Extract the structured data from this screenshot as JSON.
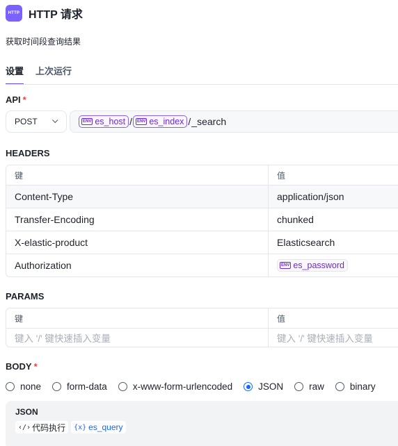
{
  "header": {
    "icon_text": "HTTP",
    "title": "HTTP 请求",
    "subtitle": "获取时间段查询结果"
  },
  "tabs": [
    {
      "label": "设置",
      "active": true
    },
    {
      "label": "上次运行",
      "active": false
    }
  ],
  "api": {
    "label": "API",
    "required_mark": "*",
    "method": "POST",
    "url": {
      "host_var": "es_host",
      "index_var": "es_index",
      "slash": "/",
      "path": "_search",
      "env_icon": "ENV"
    }
  },
  "headers": {
    "label": "HEADERS",
    "col_key": "键",
    "col_value": "值",
    "rows": [
      {
        "key": "Content-Type",
        "value": "application/json"
      },
      {
        "key": "Transfer-Encoding",
        "value": "chunked"
      },
      {
        "key": "X-elastic-product",
        "value": "Elasticsearch"
      },
      {
        "key": "Authorization",
        "value_var": "es_password"
      }
    ]
  },
  "params": {
    "label": "PARAMS",
    "col_key": "键",
    "col_value": "值",
    "key_placeholder": "键入 '/' 键快速插入变量",
    "value_placeholder": "键入 '/' 键快速插入变量"
  },
  "body": {
    "label": "BODY",
    "required_mark": "*",
    "options": [
      {
        "label": "none",
        "checked": false
      },
      {
        "label": "form-data",
        "checked": false
      },
      {
        "label": "x-www-form-urlencoded",
        "checked": false
      },
      {
        "label": "JSON",
        "checked": true
      },
      {
        "label": "raw",
        "checked": false
      },
      {
        "label": "binary",
        "checked": false
      }
    ],
    "json_title": "JSON",
    "code_tag": "代码执行",
    "code_icon": "‹/›",
    "var_icon": "{x}",
    "var_tag": "es_query"
  },
  "colors": {
    "accent": "#6b4eff",
    "env_tag": "#8b5cf6",
    "required": "#f53f3f",
    "radio_checked": "#1664ff"
  }
}
